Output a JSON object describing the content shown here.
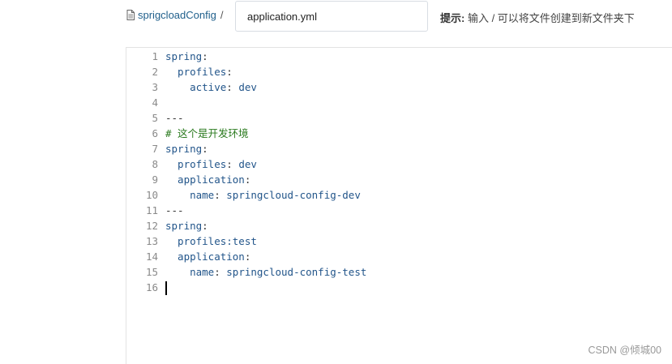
{
  "breadcrumb": {
    "repo": "sprigcloadConfig",
    "separator": "/"
  },
  "filename_input": {
    "value": "application.yml"
  },
  "hint": {
    "label": "提示:",
    "text": " 输入 / 可以将文件创建到新文件夹下"
  },
  "editor": {
    "line_numbers": [
      "1",
      "2",
      "3",
      "4",
      "5",
      "6",
      "7",
      "8",
      "9",
      "10",
      "11",
      "12",
      "13",
      "14",
      "15",
      "16"
    ],
    "lines": [
      [
        {
          "t": "spring",
          "c": "key"
        },
        {
          "t": ":",
          "c": "plain"
        }
      ],
      [
        {
          "t": "  profiles",
          "c": "key"
        },
        {
          "t": ":",
          "c": "plain"
        }
      ],
      [
        {
          "t": "    active",
          "c": "key"
        },
        {
          "t": ": ",
          "c": "plain"
        },
        {
          "t": "dev",
          "c": "val"
        }
      ],
      [],
      [
        {
          "t": "---",
          "c": "sep"
        }
      ],
      [
        {
          "t": "# 这个是开发环境",
          "c": "comment"
        }
      ],
      [
        {
          "t": "spring",
          "c": "key"
        },
        {
          "t": ":",
          "c": "plain"
        }
      ],
      [
        {
          "t": "  profiles",
          "c": "key"
        },
        {
          "t": ": ",
          "c": "plain"
        },
        {
          "t": "dev",
          "c": "val"
        }
      ],
      [
        {
          "t": "  application",
          "c": "key"
        },
        {
          "t": ":",
          "c": "plain"
        }
      ],
      [
        {
          "t": "    name",
          "c": "key"
        },
        {
          "t": ": ",
          "c": "plain"
        },
        {
          "t": "springcloud-config-dev",
          "c": "val"
        }
      ],
      [
        {
          "t": "---",
          "c": "sep"
        }
      ],
      [
        {
          "t": "spring",
          "c": "key"
        },
        {
          "t": ":",
          "c": "plain"
        }
      ],
      [
        {
          "t": "  profiles:test",
          "c": "key"
        }
      ],
      [
        {
          "t": "  application",
          "c": "key"
        },
        {
          "t": ":",
          "c": "plain"
        }
      ],
      [
        {
          "t": "    name",
          "c": "key"
        },
        {
          "t": ": ",
          "c": "plain"
        },
        {
          "t": "springcloud-config-test",
          "c": "val"
        }
      ],
      []
    ],
    "cursor_line": 16
  },
  "watermark": "CSDN @倾城00",
  "colors": {
    "key": "#22558a",
    "comment": "#2a7a1e",
    "link": "#1f5f8b"
  },
  "icons": {
    "file": "file-icon"
  }
}
